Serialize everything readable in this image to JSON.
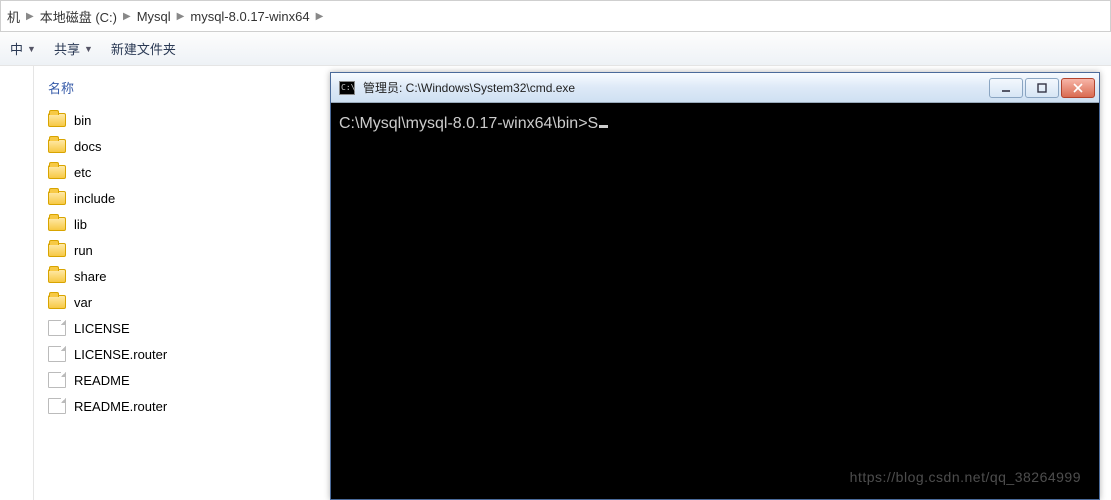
{
  "breadcrumb": {
    "first_fragment": "机",
    "items": [
      "本地磁盘 (C:)",
      "Mysql",
      "mysql-8.0.17-winx64"
    ]
  },
  "toolbar": {
    "left_fragment": "中",
    "share_label": "共享",
    "newfolder_label": "新建文件夹"
  },
  "filepane": {
    "column_header": "名称",
    "entries": [
      {
        "name": "bin",
        "kind": "folder"
      },
      {
        "name": "docs",
        "kind": "folder"
      },
      {
        "name": "etc",
        "kind": "folder"
      },
      {
        "name": "include",
        "kind": "folder"
      },
      {
        "name": "lib",
        "kind": "folder"
      },
      {
        "name": "run",
        "kind": "folder"
      },
      {
        "name": "share",
        "kind": "folder"
      },
      {
        "name": "var",
        "kind": "folder"
      },
      {
        "name": "LICENSE",
        "kind": "file"
      },
      {
        "name": "LICENSE.router",
        "kind": "file"
      },
      {
        "name": "README",
        "kind": "file"
      },
      {
        "name": "README.router",
        "kind": "file"
      }
    ]
  },
  "cmd": {
    "title": "管理员: C:\\Windows\\System32\\cmd.exe",
    "prompt_line": "C:\\Mysql\\mysql-8.0.17-winx64\\bin>S"
  },
  "watermark": "https://blog.csdn.net/qq_38264999"
}
